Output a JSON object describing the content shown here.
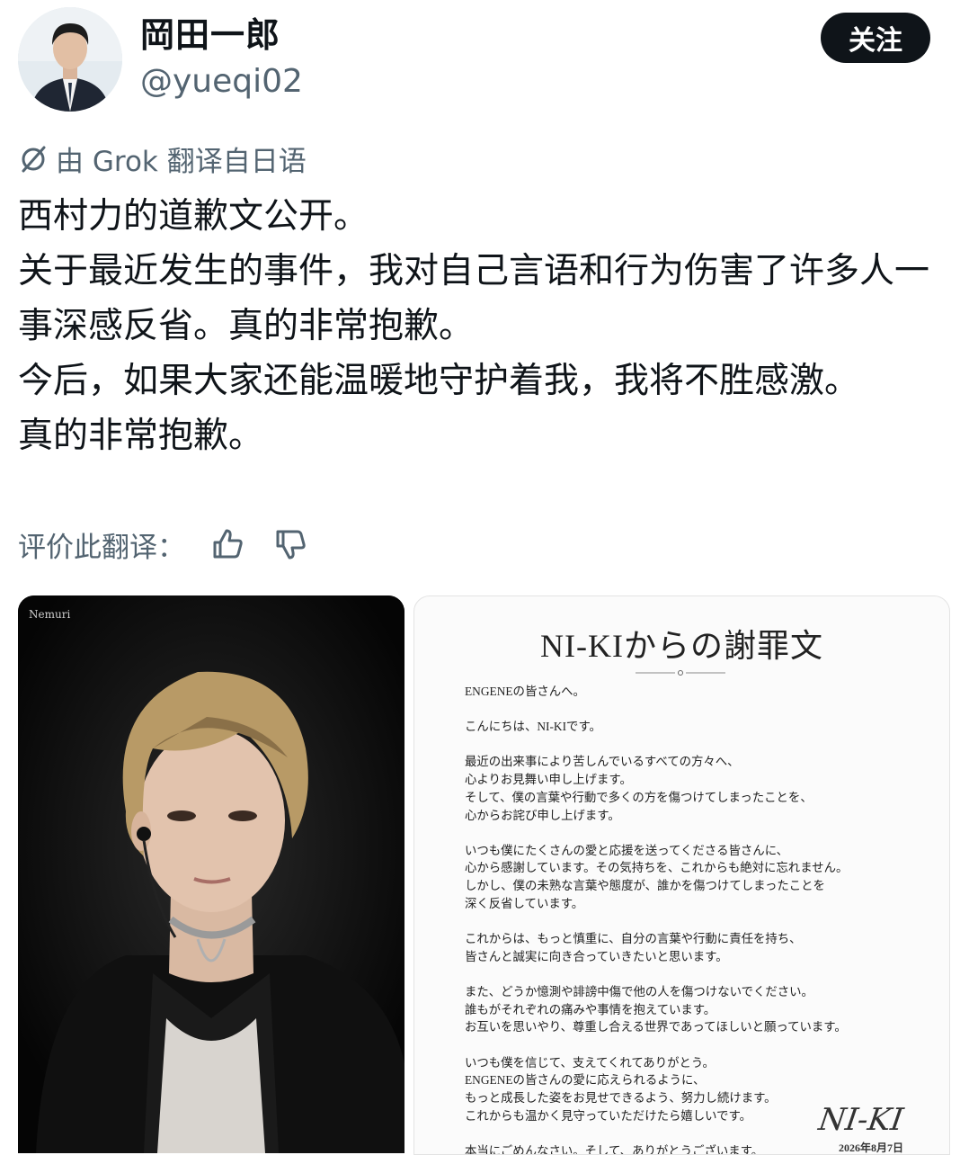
{
  "author": {
    "display_name": "岡田一郎",
    "handle": "@yueqi02"
  },
  "follow_label": "关注",
  "translation": {
    "notice": "由 Grok 翻译自日语",
    "rate_label": "评价此翻译："
  },
  "tweet": {
    "lines": [
      "西村力的道歉文公开。",
      "关于最近发生的事件，我对自己言语和行为伤害了许多人一事深感反省。真的非常抱歉。",
      "今后，如果大家还能温暖地守护着我，我将不胜感激。",
      "真的非常抱歉。"
    ]
  },
  "media": {
    "photo_watermark": "Nemuri",
    "letter": {
      "title": "NI-KIからの謝罪文",
      "paragraphs": [
        [
          "ENGENEの皆さんへ。"
        ],
        [
          "こんにちは、NI-KIです。"
        ],
        [
          "最近の出来事により苦しんでいるすべての方々へ、",
          "心よりお見舞い申し上げます。",
          "そして、僕の言葉や行動で多くの方を傷つけてしまったことを、",
          "心からお詫び申し上げます。"
        ],
        [
          "いつも僕にたくさんの愛と応援を送ってくださる皆さんに、",
          "心から感謝しています。その気持ちを、これからも絶対に忘れません。",
          "しかし、僕の未熟な言葉や態度が、誰かを傷つけてしまったことを",
          "深く反省しています。"
        ],
        [
          "これからは、もっと慎重に、自分の言葉や行動に責任を持ち、",
          "皆さんと誠実に向き合っていきたいと思います。"
        ],
        [
          "また、どうか憶測や誹謗中傷で他の人を傷つけないでください。",
          "誰もがそれぞれの痛みや事情を抱えています。",
          "お互いを思いやり、尊重し合える世界であってほしいと願っています。"
        ],
        [
          "いつも僕を信じて、支えてくれてありがとう。",
          "ENGENEの皆さんの愛に応えられるように、",
          "もっと成長した姿をお見せできるよう、努力し続けます。",
          "これからも温かく見守っていただけたら嬉しいです。"
        ],
        [
          "本当にごめんなさい。そして、ありがとうございます。"
        ]
      ],
      "signature": "NI-KI",
      "date": "2026年8月7日"
    }
  },
  "colors": {
    "text": "#0f1419",
    "secondary": "#536471",
    "follow_bg": "#0f1419"
  },
  "icons": [
    "grok-icon",
    "thumbs-up-icon",
    "thumbs-down-icon"
  ]
}
